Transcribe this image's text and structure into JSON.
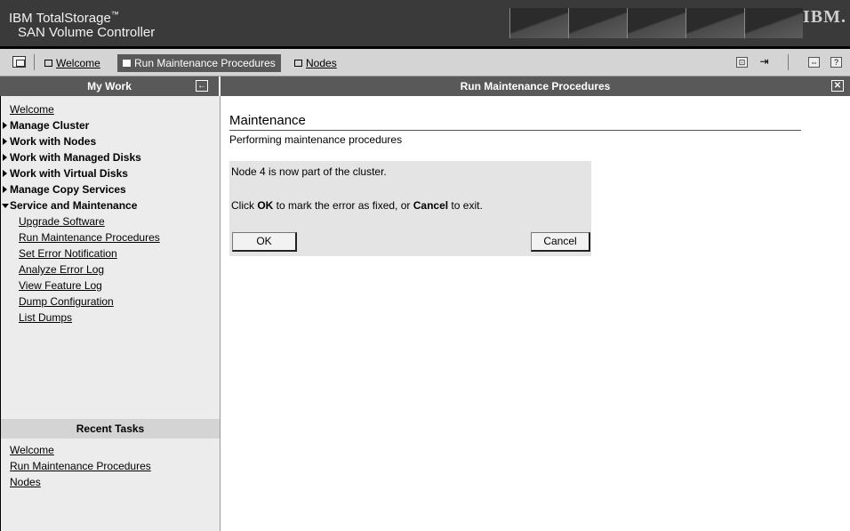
{
  "banner": {
    "line1": "IBM TotalStorage",
    "trademark": "™",
    "line2": "SAN Volume Controller",
    "logo_text": "IBM."
  },
  "tabs": [
    {
      "label": "Welcome",
      "active": false
    },
    {
      "label": "Run Maintenance Procedures",
      "active": true
    },
    {
      "label": "Nodes",
      "active": false
    }
  ],
  "toolbar_icons": [
    "pages-icon",
    "refresh-icon",
    "logout-icon",
    "expand-icon",
    "help-icon"
  ],
  "toolbar_glyphs": {
    "refresh": "⊡",
    "logout": "⇥",
    "expand": "⇔",
    "help": "?"
  },
  "left_panel": {
    "title": "My Work",
    "collapse_glyph": "←",
    "items": [
      {
        "label": "Welcome",
        "type": "link"
      },
      {
        "label": "Manage Cluster",
        "type": "section",
        "expanded": false
      },
      {
        "label": "Work with Nodes",
        "type": "section",
        "expanded": false
      },
      {
        "label": "Work with Managed Disks",
        "type": "section",
        "expanded": false
      },
      {
        "label": "Work with Virtual Disks",
        "type": "section",
        "expanded": false
      },
      {
        "label": "Manage Copy Services",
        "type": "section",
        "expanded": false
      },
      {
        "label": "Service and Maintenance",
        "type": "section",
        "expanded": true
      }
    ],
    "service_items": [
      "Upgrade Software",
      "Run Maintenance Procedures",
      "Set Error Notification",
      "Analyze Error Log",
      "View Feature Log",
      "Dump Configuration",
      "List Dumps"
    ],
    "recent_title": "Recent Tasks",
    "recent_items": [
      "Welcome",
      "Run Maintenance Procedures",
      "Nodes"
    ]
  },
  "content": {
    "bar_title": "Run Maintenance Procedures",
    "close_glyph": "✕",
    "heading": "Maintenance",
    "subtitle": "Performing maintenance procedures",
    "message": "Node 4 is now part of the cluster.",
    "instr_pre": "Click ",
    "instr_ok": "OK",
    "instr_mid": " to mark the error as fixed, or ",
    "instr_cancel": "Cancel",
    "instr_post": " to exit.",
    "ok_label": "OK",
    "cancel_label": "Cancel"
  },
  "colors": {
    "banner": "#3a3a3a",
    "header_bar": "#595959",
    "sidebar": "#ececec",
    "panel": "#e4e4e4"
  }
}
